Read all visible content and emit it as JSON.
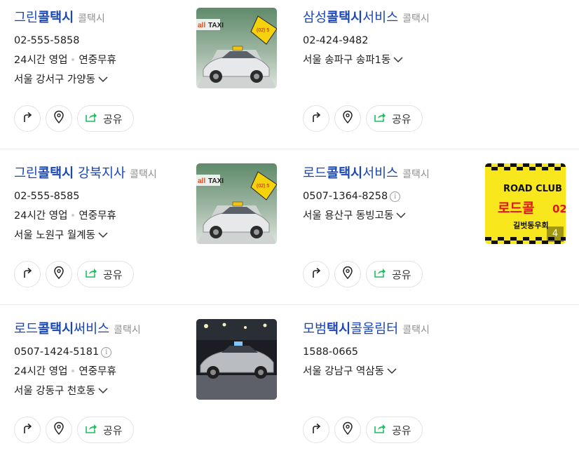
{
  "cards": [
    {
      "title_pre": "그린",
      "title_hl": "콜택시",
      "title_post": "",
      "category": "콜택시",
      "phone": "02-555-5858",
      "hours": "24시간 영업",
      "holiday": "연중무휴",
      "address": "서울 강서구 가양동",
      "share": "공유",
      "image": "taxi-ad"
    },
    {
      "title_pre": "삼성",
      "title_hl": "콜택시",
      "title_post": "서비스",
      "category": "콜택시",
      "phone": "02-424-9482",
      "address": "서울 송파구 송파1동",
      "share": "공유"
    },
    {
      "title_pre": "그린",
      "title_hl": "콜택시",
      "title_post": " 강북지사",
      "category": "콜택시",
      "phone": "02-555-8585",
      "hours": "24시간 영업",
      "holiday": "연중무휴",
      "address": "서울 노원구 월계동",
      "share": "공유",
      "image": "taxi-ad"
    },
    {
      "title_pre": "로드",
      "title_hl": "콜택시",
      "title_post": "서비스",
      "category": "콜택시",
      "phone": "0507-1364-8258",
      "address": "서울 용산구 동빙고동",
      "share": "공유",
      "image": "road-club",
      "image_text": {
        "top": "ROAD CLUB",
        "main": "로드콜",
        "side": "02",
        "bottom": "길벗동우회",
        "count": "4"
      }
    },
    {
      "title_pre": "로드",
      "title_hl": "콜택시",
      "title_post": "써비스",
      "category": "콜택시",
      "phone": "0507-1424-5181",
      "hours": "24시간 영업",
      "holiday": "연중무휴",
      "address": "서울 강동구 천호동",
      "share": "공유",
      "image": "night-car"
    },
    {
      "title_pre": "모범",
      "title_hl": "택시",
      "title_post": "콜울림터",
      "category": "콜택시",
      "phone": "1588-0665",
      "address": "서울 강남구 역삼동",
      "share": "공유"
    }
  ],
  "colors": {
    "title": "#1946b8",
    "share_icon": "#1dbf5e",
    "road_yellow": "#f8e71c"
  },
  "icons": {
    "directions": "turn-right-arrow-icon",
    "pin": "map-pin-icon",
    "share": "share-icon",
    "expand": "chevron-down-icon",
    "info": "info-icon"
  }
}
